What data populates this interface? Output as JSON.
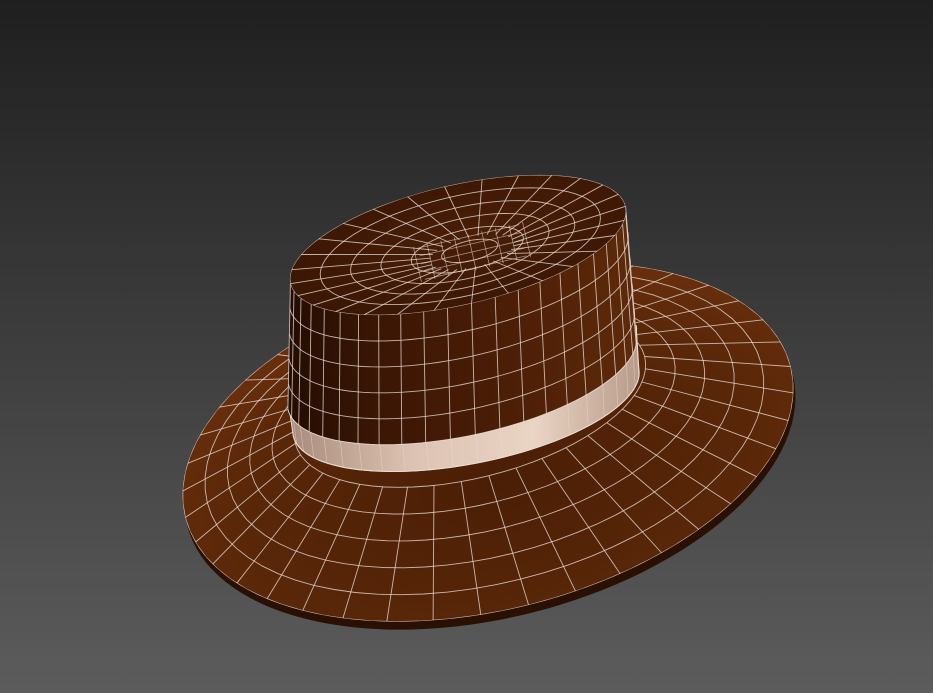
{
  "viewport": {
    "background_top": "#1f1f1f",
    "background_bottom": "#5c5c5c"
  },
  "model": {
    "parts": [
      "brim",
      "ribbon-band",
      "crown",
      "crown-top"
    ],
    "colors": {
      "felt_dark": "#3a1604",
      "felt_mid": "#5a2708",
      "felt_light": "#6e3410",
      "ribbon": "#dcc2b2",
      "ribbon_shadow": "#a88a7a",
      "wireframe": "#e8dcd4"
    },
    "wireframe_visible": true
  }
}
